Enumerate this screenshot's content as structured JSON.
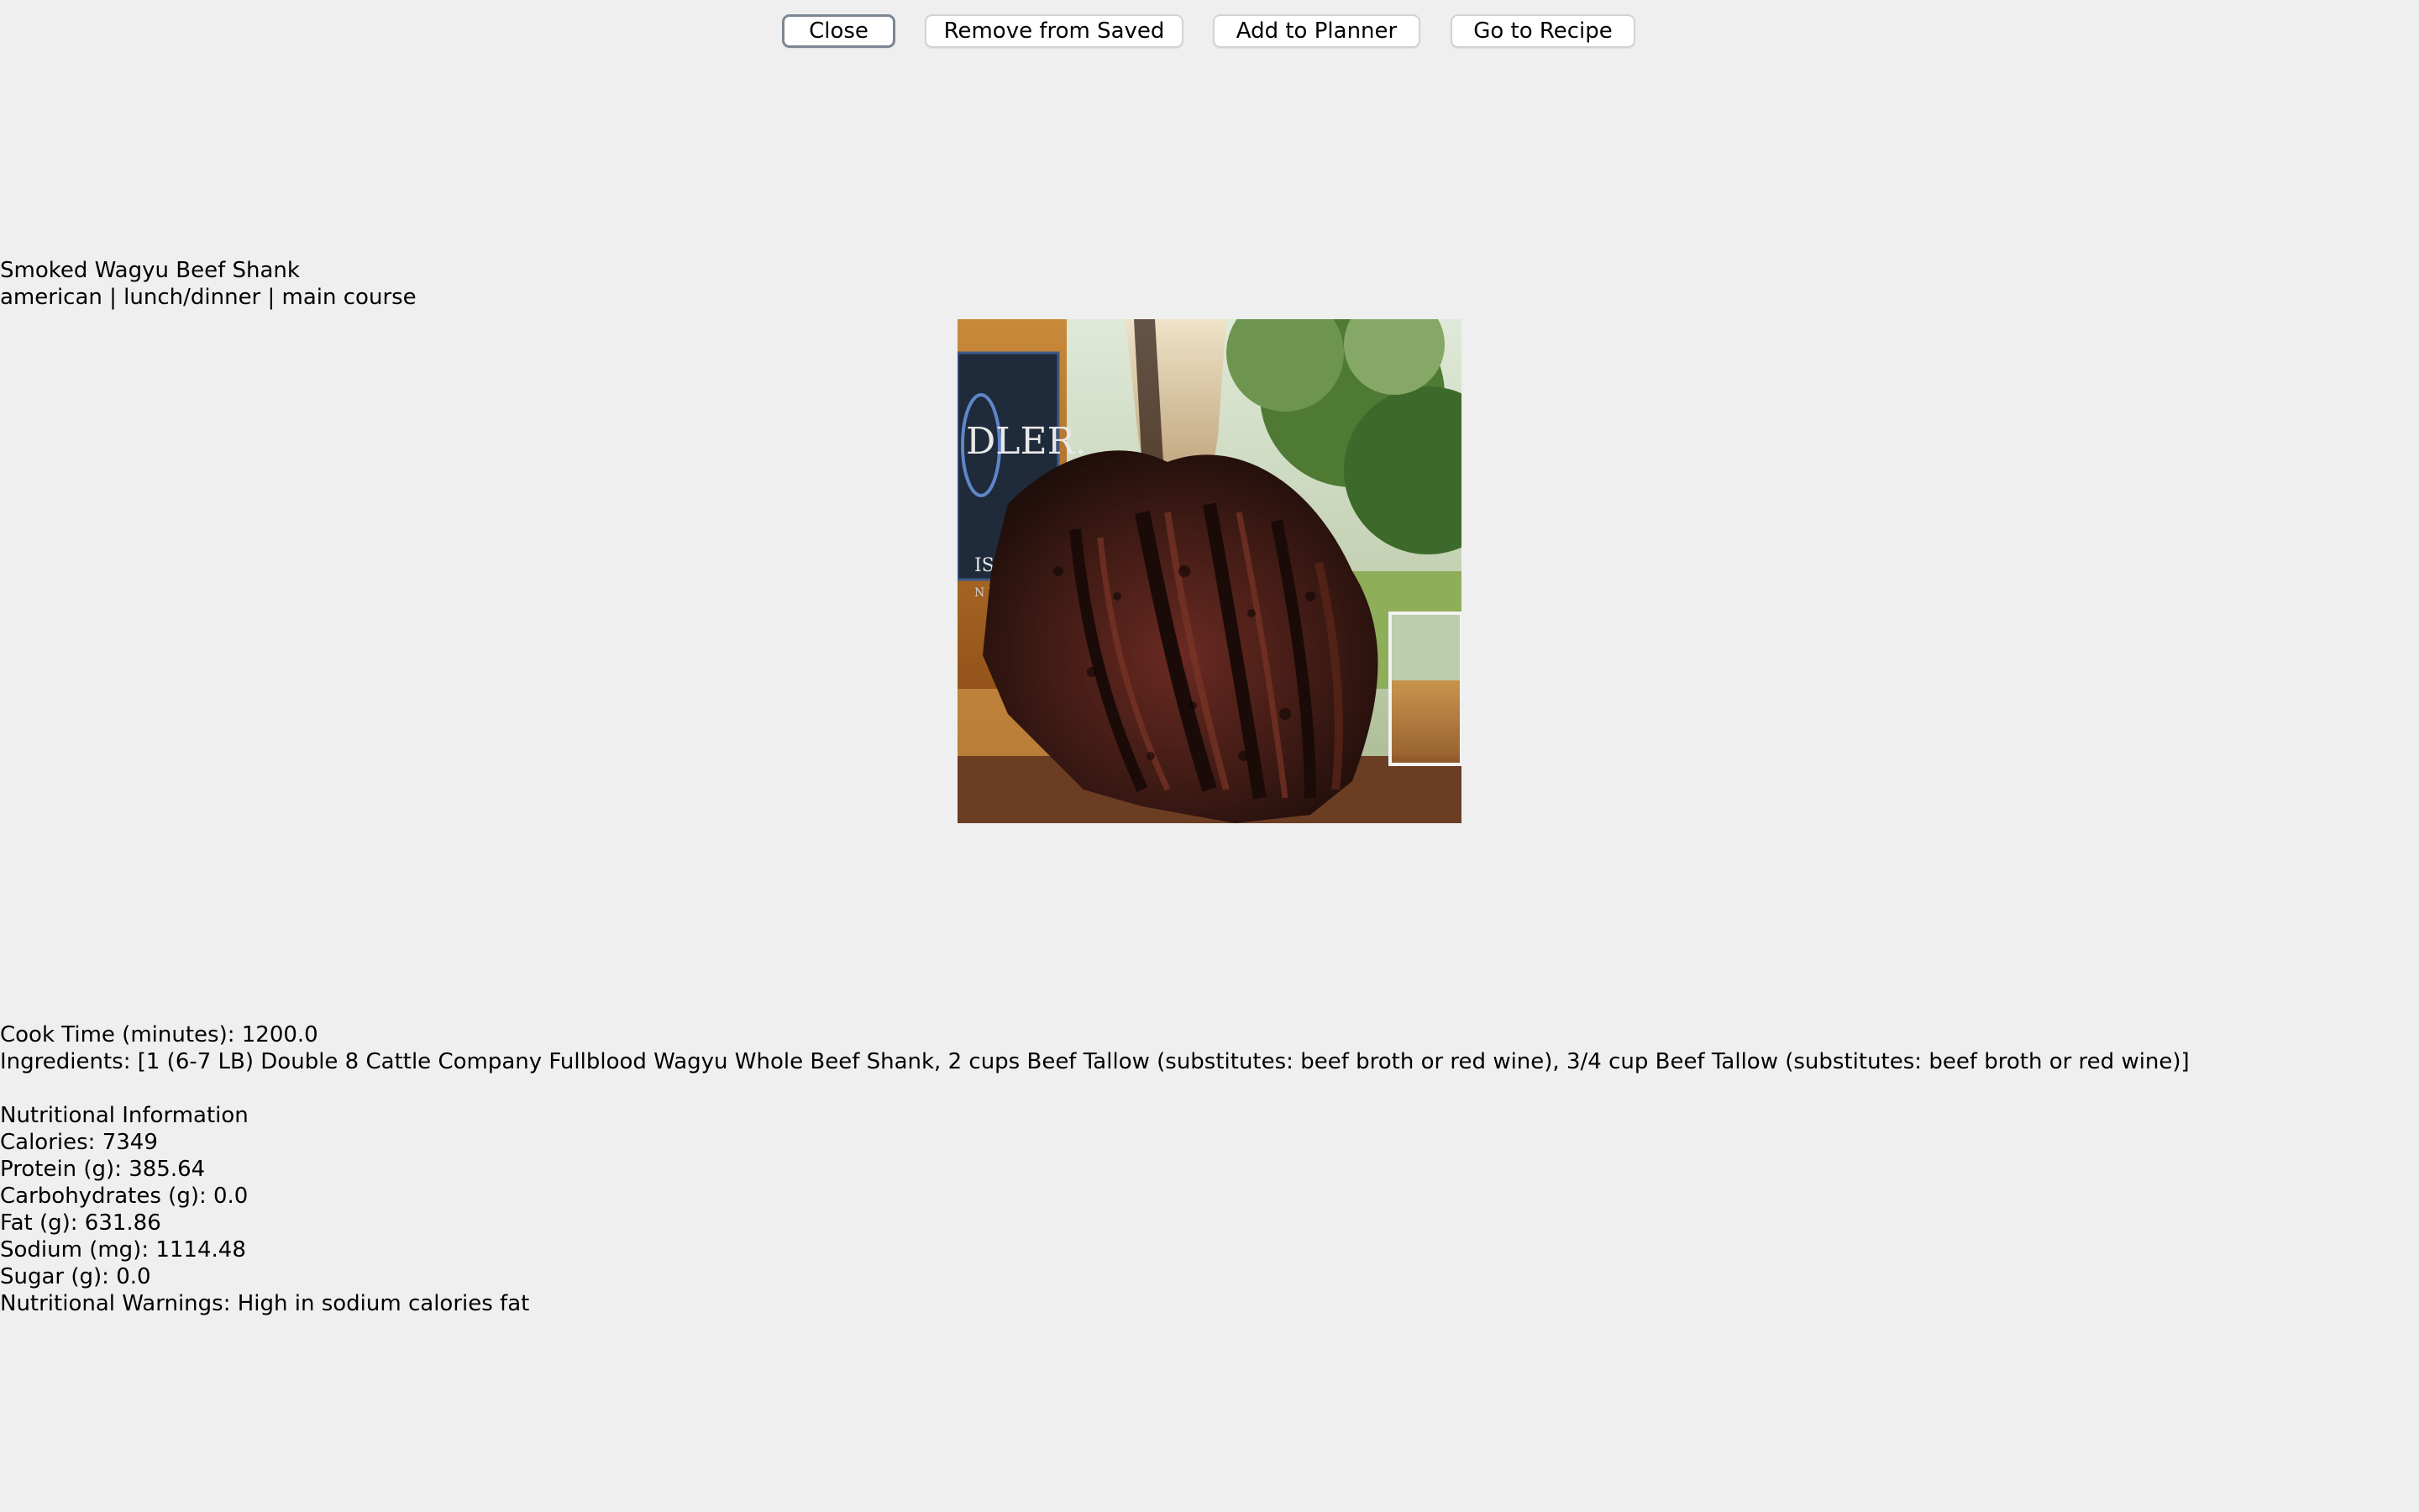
{
  "toolbar": {
    "close_label": "Close",
    "remove_label": "Remove from Saved",
    "planner_label": "Add to Planner",
    "recipe_label": "Go to Recipe"
  },
  "recipe": {
    "title": "Smoked Wagyu Beef Shank",
    "tags": "american | lunch/dinner | main course",
    "cook_time": "Cook Time (minutes): 1200.0",
    "ingredients": "Ingredients: [1 (6-7 LB) Double 8 Cattle Company Fullblood Wagyu Whole Beef Shank, 2 cups Beef Tallow (substitutes: beef broth or red wine), 3/4 cup Beef Tallow (substitutes: beef broth or red wine)]",
    "image": {
      "bottle_label_text": "DLER.",
      "bottle_label_text2": "ISON",
      "bottle_label_text3": "N WHI"
    }
  },
  "nutrition": {
    "heading": "Nutritional Information",
    "calories": "Calories: 7349",
    "protein": "Protein (g): 385.64",
    "carbohydrates": "Carbohydrates (g): 0.0",
    "fat": "Fat (g): 631.86",
    "sodium": "Sodium (mg): 1114.48",
    "sugar": "Sugar (g): 0.0",
    "warnings": "Nutritional Warnings: High in sodium calories fat"
  },
  "colors": {
    "background": "#efefef",
    "button_bg": "#ffffff",
    "default_button_border": "#7d8793"
  }
}
